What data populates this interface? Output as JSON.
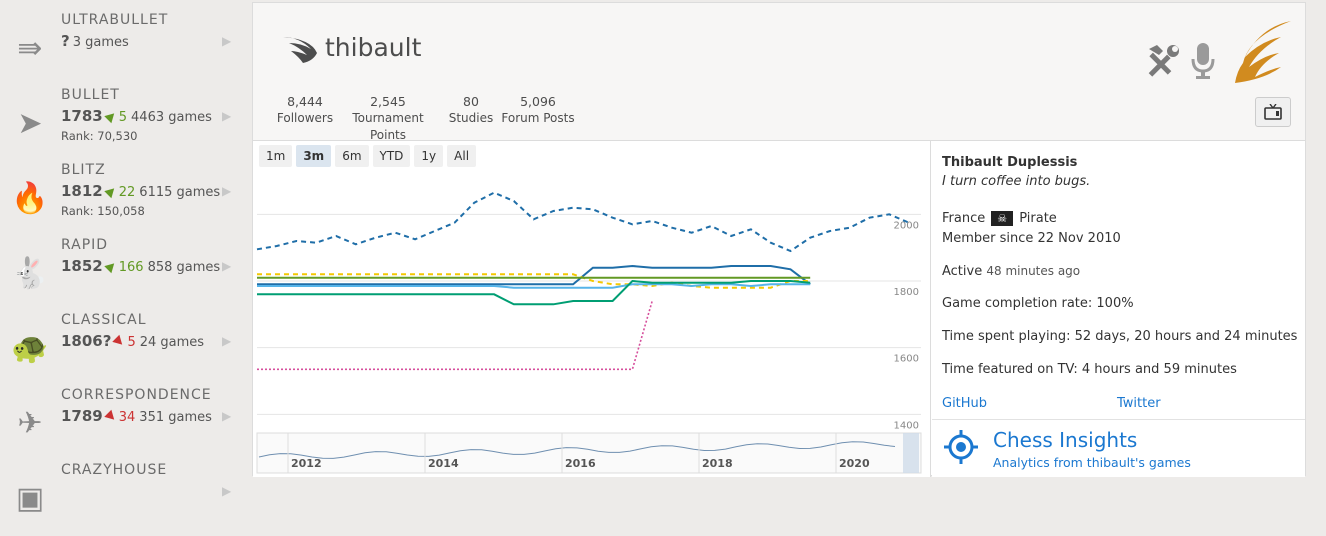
{
  "sidebar": {
    "perfs": [
      {
        "name": "ULTRABULLET",
        "rating": "?",
        "change": "",
        "direction": "none",
        "games": "3 games",
        "rank": "",
        "icon": "ultrabullet-icon"
      },
      {
        "name": "BULLET",
        "rating": "1783",
        "change": "5",
        "direction": "up",
        "games": "4463 games",
        "rank": "Rank: 70,530",
        "icon": "bullet-icon"
      },
      {
        "name": "BLITZ",
        "rating": "1812",
        "change": "22",
        "direction": "up",
        "games": "6115 games",
        "rank": "Rank: 150,058",
        "icon": "blitz-fire-icon"
      },
      {
        "name": "RAPID",
        "rating": "1852",
        "change": "166",
        "direction": "up",
        "games": "858 games",
        "rank": "",
        "icon": "rapid-rabbit-icon"
      },
      {
        "name": "CLASSICAL",
        "rating": "1806?",
        "change": "5",
        "direction": "down",
        "games": "24 games",
        "rank": "",
        "icon": "classical-turtle-icon"
      },
      {
        "name": "CORRESPONDENCE",
        "rating": "1789",
        "change": "34",
        "direction": "down",
        "games": "351 games",
        "rank": "",
        "icon": "correspondence-plane-icon"
      },
      {
        "name": "CRAZYHOUSE",
        "rating": "",
        "change": "",
        "direction": "none",
        "games": "",
        "rank": "",
        "icon": "crazyhouse-icon"
      }
    ]
  },
  "header": {
    "username": "thibault",
    "stats": [
      {
        "value": "8,444",
        "label": "Followers"
      },
      {
        "value": "2,545",
        "label": "Tournament Points"
      },
      {
        "value": "80",
        "label": "Studies"
      },
      {
        "value": "5,096",
        "label": "Forum Posts"
      }
    ]
  },
  "chart": {
    "range_buttons": [
      "1m",
      "3m",
      "6m",
      "YTD",
      "1y",
      "All"
    ],
    "active_range": "3m"
  },
  "chart_data": {
    "type": "line",
    "y_ticks": [
      "2000",
      "1800",
      "1600",
      "1400"
    ],
    "navigator_years": [
      "2012",
      "2014",
      "2016",
      "2018",
      "2020"
    ],
    "series": [
      {
        "color": "#1f6ea8",
        "style": "dashed",
        "values": [
          1895,
          1905,
          1920,
          1915,
          1935,
          1910,
          1930,
          1945,
          1925,
          1950,
          1975,
          2035,
          2065,
          2040,
          1985,
          2010,
          2020,
          2015,
          1990,
          1970,
          1980,
          1960,
          1945,
          1965,
          1935,
          1955,
          1915,
          1890,
          1930,
          1950,
          1960,
          1990,
          2000,
          1975
        ]
      },
      {
        "color": "#1f6ea8",
        "style": "solid",
        "values": [
          1790,
          1790,
          1790,
          1790,
          1790,
          1790,
          1790,
          1790,
          1790,
          1790,
          1790,
          1790,
          1790,
          1790,
          1790,
          1790,
          1790,
          1840,
          1840,
          1845,
          1840,
          1840,
          1840,
          1840,
          1845,
          1845,
          1845,
          1835,
          1790
        ]
      },
      {
        "color": "#f4c800",
        "style": "dashed",
        "values": [
          1820,
          1820,
          1820,
          1820,
          1820,
          1820,
          1820,
          1820,
          1820,
          1820,
          1820,
          1820,
          1820,
          1820,
          1820,
          1820,
          1820,
          1800,
          1790,
          1790,
          1785,
          1795,
          1785,
          1780,
          1780,
          1780,
          1780,
          1800,
          1800
        ]
      },
      {
        "color": "#629924",
        "style": "solid",
        "values": [
          1810,
          1810,
          1810,
          1810,
          1810,
          1810,
          1810,
          1810,
          1810,
          1810,
          1810,
          1810,
          1810,
          1810,
          1810,
          1810,
          1810,
          1810,
          1810,
          1810,
          1810,
          1810,
          1810,
          1810,
          1810,
          1810,
          1810,
          1810,
          1810
        ]
      },
      {
        "color": "#56b4e9",
        "style": "solid",
        "values": [
          1785,
          1785,
          1785,
          1785,
          1785,
          1785,
          1785,
          1785,
          1785,
          1785,
          1785,
          1785,
          1785,
          1780,
          1780,
          1780,
          1780,
          1780,
          1780,
          1790,
          1790,
          1790,
          1785,
          1790,
          1790,
          1785,
          1790,
          1790,
          1790
        ]
      },
      {
        "color": "#009e73",
        "style": "solid",
        "values": [
          1760,
          1760,
          1760,
          1760,
          1760,
          1760,
          1760,
          1760,
          1760,
          1760,
          1760,
          1760,
          1760,
          1730,
          1730,
          1730,
          1740,
          1740,
          1740,
          1800,
          1795,
          1795,
          1795,
          1795,
          1795,
          1800,
          1800,
          1800,
          1795
        ]
      },
      {
        "color": "#d64f9c",
        "style": "dotted",
        "values": [
          1535,
          1535,
          1535,
          1535,
          1535,
          1535,
          1535,
          1535,
          1535,
          1535,
          1535,
          1535,
          1535,
          1535,
          1535,
          1535,
          1535,
          1535,
          1535,
          1535,
          1740
        ]
      }
    ]
  },
  "profile": {
    "real_name": "Thibault Duplessis",
    "bio": "I turn coffee into bugs.",
    "country": "France",
    "flag_text": "Pirate",
    "member_since": "Member since 22 Nov 2010",
    "active_label": "Active",
    "active_value": "48 minutes ago",
    "completion": "Game completion rate: 100%",
    "time_playing": "Time spent playing: 52 days, 20 hours and 24 minutes",
    "time_tv": "Time featured on TV: 4 hours and 59 minutes",
    "link_github": "GitHub",
    "link_twitter": "Twitter"
  },
  "insights": {
    "title": "Chess Insights",
    "subtitle": "Analytics from thibault's games"
  },
  "colors": {
    "accent": "#1b78d0",
    "brand_orange": "#d18b1f",
    "up": "#629924",
    "down": "#cc3333"
  }
}
